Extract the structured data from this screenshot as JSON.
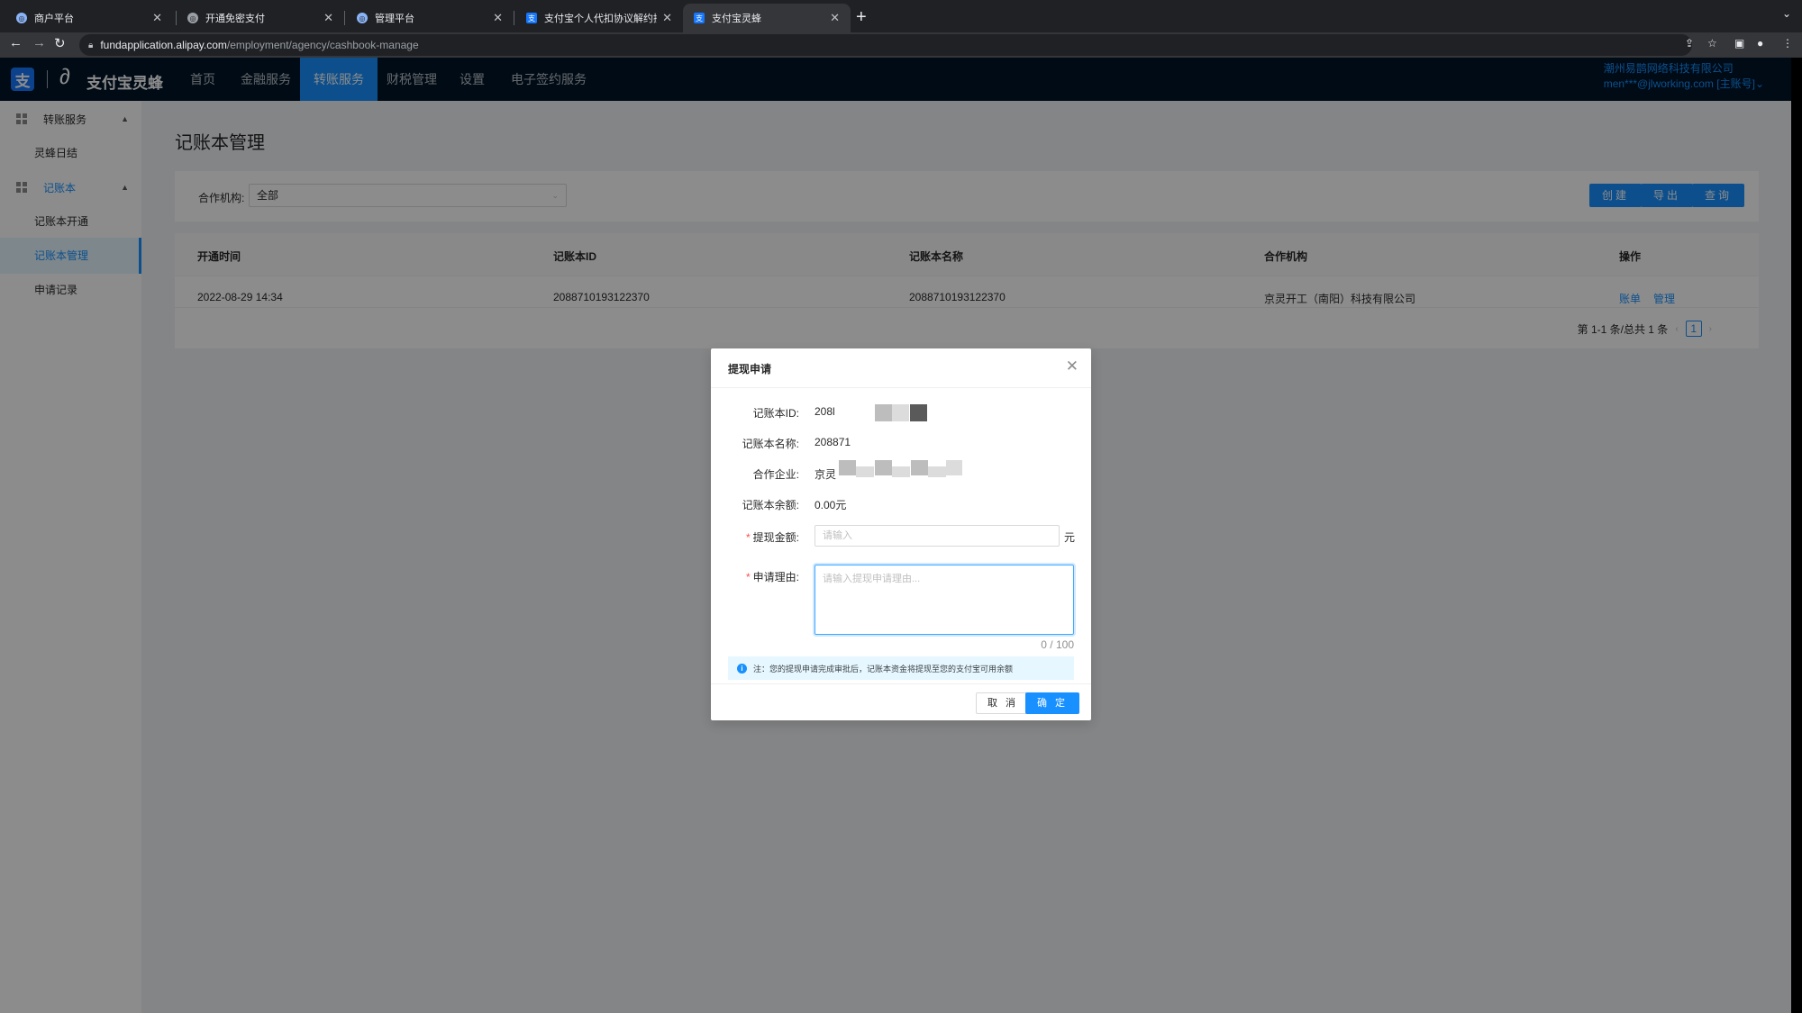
{
  "browser": {
    "tabs": [
      {
        "title": "商户平台",
        "active": false
      },
      {
        "title": "开通免密支付",
        "active": false
      },
      {
        "title": "管理平台",
        "active": false
      },
      {
        "title": "支付宝个人代扣协议解约接口 - 支",
        "active": false
      },
      {
        "title": "支付宝灵蜂",
        "active": true
      }
    ],
    "url_host": "fundapplication.alipay.com",
    "url_path": "/employment/agency/cashbook-manage"
  },
  "app": {
    "logo_text": "支付宝灵蜂",
    "nav": [
      "首页",
      "金融服务",
      "转账服务",
      "财税管理",
      "设置",
      "电子签约服务"
    ],
    "nav_active": "转账服务",
    "account_company": "潮州易鹊网络科技有限公司",
    "account_user": "men***@jlworking.com [主账号]",
    "sider": {
      "group1": "转账服务",
      "group1_items": [
        "灵蜂日结"
      ],
      "group2": "记账本",
      "group2_items": [
        "记账本开通",
        "记账本管理",
        "申请记录"
      ],
      "selected": "记账本管理"
    }
  },
  "page": {
    "title": "记账本管理",
    "filter_label": "合作机构:",
    "filter_value": "全部",
    "buttons": [
      "创建",
      "导出",
      "查询"
    ],
    "table": {
      "headers": [
        "开通时间",
        "记账本ID",
        "记账本名称",
        "合作机构",
        "操作"
      ],
      "rows": [
        {
          "time": "2022-08-29 14:34",
          "id": "2088710193122370",
          "name": "2088710193122370",
          "org": "京灵开工（南阳）科技有限公司",
          "actions": [
            "账单",
            "管理"
          ]
        }
      ]
    },
    "pagination": {
      "summary": "第 1-1 条/总共 1 条",
      "current": "1"
    }
  },
  "modal": {
    "title": "提现申请",
    "fields": {
      "id_label": "记账本ID:",
      "id_value": "208l",
      "name_label": "记账本名称:",
      "name_value": "208871",
      "company_label": "合作企业:",
      "company_value": "京灵",
      "balance_label": "记账本余额:",
      "balance_value": "0.00元",
      "amount_label": "提现金额:",
      "amount_placeholder": "请输入",
      "amount_unit": "元",
      "reason_label": "申请理由:",
      "reason_placeholder": "请输入提现申请理由...",
      "reason_counter": "0 / 100"
    },
    "notice": "注：您的提现申请完成审批后，记账本资金将提现至您的支付宝可用余额",
    "cancel_label": "取 消",
    "ok_label": "确 定"
  },
  "colors": {
    "primary": "#1890ff",
    "nav_bg": "#001529",
    "required": "#ff4d4f"
  }
}
